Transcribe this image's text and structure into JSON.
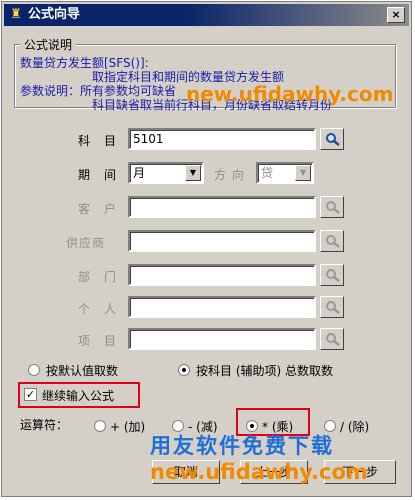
{
  "window": {
    "title": "公式向导",
    "close_label": "×"
  },
  "description": {
    "legend": "公式说明",
    "function": "数量贷方发生额[SFS()]:",
    "function_detail": "取指定科目和期间的数量贷方发生额",
    "params_prefix": "参数说明：所有参数均可缺省",
    "params_detail": "科目缺省取当前行科目，月份缺省取结转月份"
  },
  "fields": {
    "subject": {
      "label": "科　目",
      "value": "5101"
    },
    "period": {
      "label": "期　间",
      "value": "月"
    },
    "direction": {
      "label": "方 向",
      "value": "贷"
    },
    "customer": {
      "label": "客　户",
      "value": ""
    },
    "supplier": {
      "label": "供应商",
      "value": ""
    },
    "department": {
      "label": "部　门",
      "value": ""
    },
    "person": {
      "label": "个　人",
      "value": ""
    },
    "project": {
      "label": "项　目",
      "value": ""
    }
  },
  "fetch_mode": {
    "default_label": "按默认值取数",
    "subject_label": "按科目 (辅助项) 总数取数",
    "selected": "subject"
  },
  "continue": {
    "label": "继续输入公式",
    "checked": true,
    "mark": "✓"
  },
  "operators": {
    "label": "运算符：",
    "add": "+ (加)",
    "sub": "- (减)",
    "mul": "* (乘)",
    "div": "/ (除)",
    "selected": "mul"
  },
  "buttons": {
    "cancel": "取消",
    "prev": "上一步",
    "next": "下一步"
  },
  "watermark": {
    "url1": "new.ufidawhy.com",
    "brand": "用友软件免费下载",
    "url2": "new.ufidawhy.com"
  },
  "colors": {
    "title_bar": "#0a246a",
    "highlight": "#e0001a",
    "watermark_blue": "#1f6fd6",
    "watermark_orange": "#f08a00"
  },
  "icons": {
    "search": "magnifier-icon",
    "app": "app-icon"
  }
}
